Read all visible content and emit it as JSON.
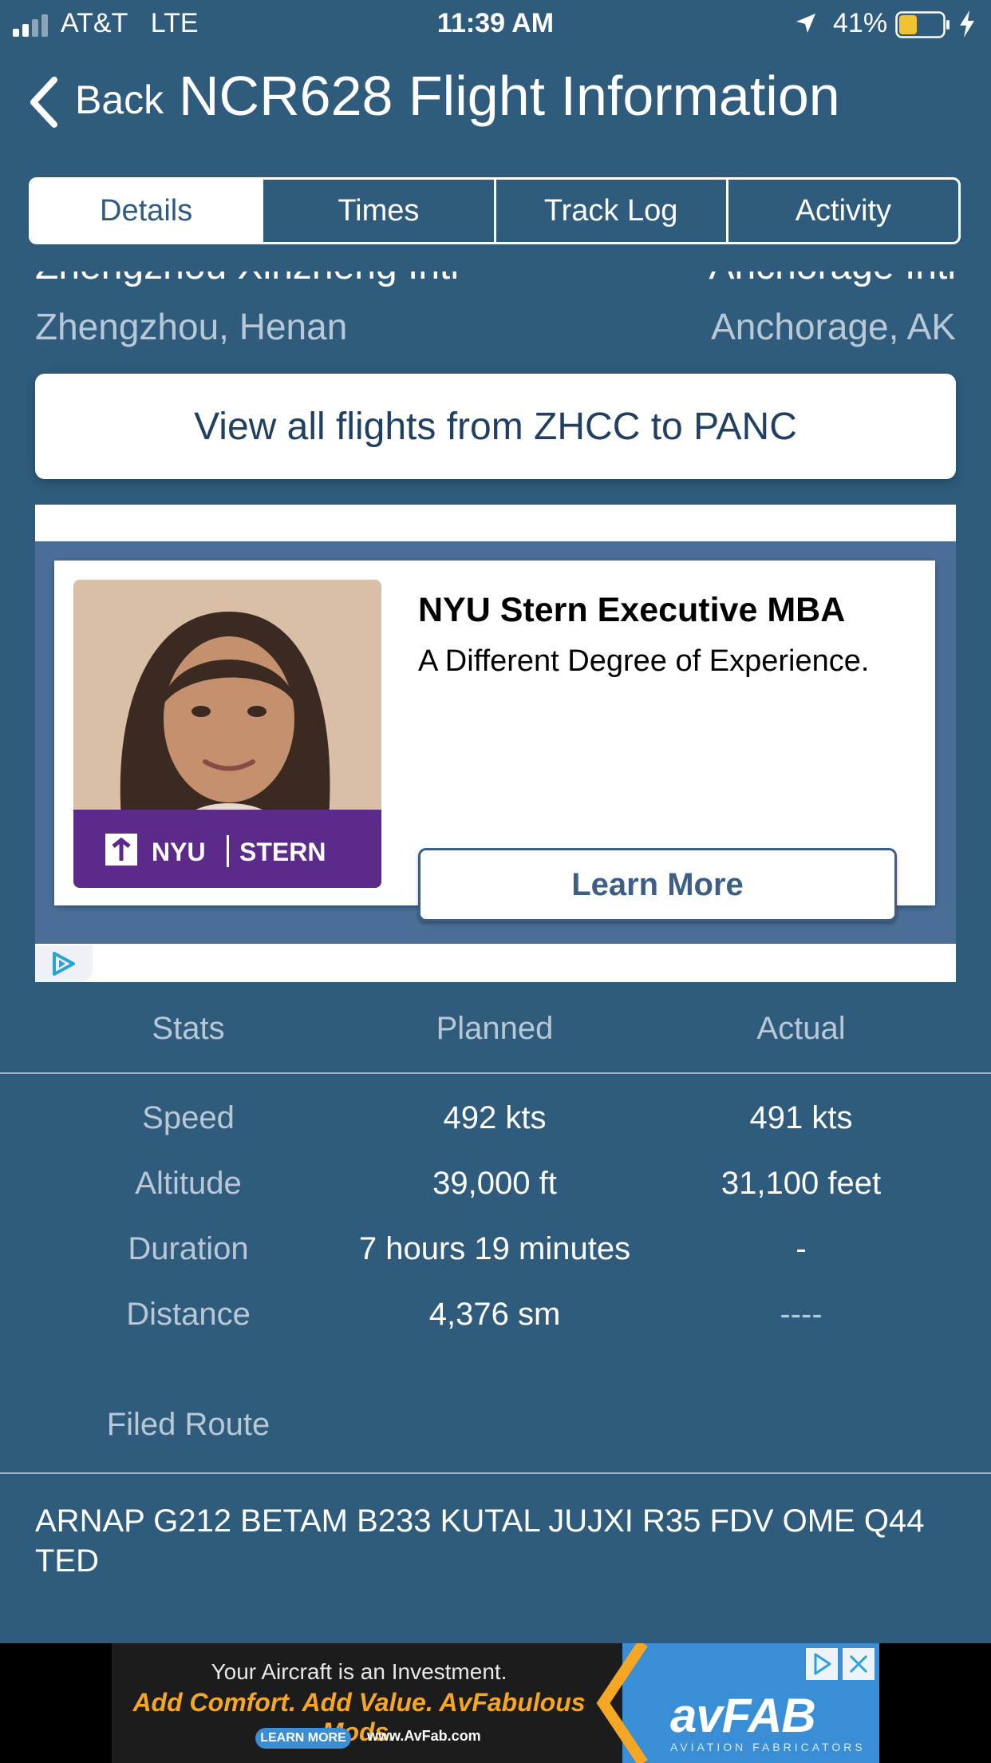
{
  "status_bar": {
    "carrier": "AT&T",
    "network": "LTE",
    "time": "11:39 AM",
    "battery_percent": "41%",
    "signal_bars_active": 2,
    "signal_bars_total": 4,
    "battery_level": 0.41,
    "battery_color": "#f2c230"
  },
  "nav": {
    "back_label": "Back",
    "title": "NCR628 Flight Information"
  },
  "tabs": [
    {
      "label": "Details",
      "active": true
    },
    {
      "label": "Times",
      "active": false
    },
    {
      "label": "Track Log",
      "active": false
    },
    {
      "label": "Activity",
      "active": false
    }
  ],
  "route": {
    "origin_name": "Zhengzhou Xinzheng Intl",
    "origin_city": "Zhengzhou, Henan",
    "destination_name": "Anchorage Intl",
    "destination_city": "Anchorage, AK"
  },
  "view_flights_button": "View all flights from ZHCC to PANC",
  "ad": {
    "headline": "NYU Stern Executive MBA",
    "body": "A Different Degree of Experience.",
    "cta": "Learn More",
    "logo_left": "NYU",
    "logo_right": "STERN",
    "background_color": "#4a6e98"
  },
  "stats": {
    "headers": [
      "Stats",
      "Planned",
      "Actual"
    ],
    "rows": [
      {
        "label": "Speed",
        "planned": "492 kts",
        "actual": "491 kts"
      },
      {
        "label": "Altitude",
        "planned": "39,000 ft",
        "actual": "31,100 feet"
      },
      {
        "label": "Duration",
        "planned": "7 hours 19 minutes",
        "actual": "-"
      },
      {
        "label": "Distance",
        "planned": "4,376 sm",
        "actual": "----"
      }
    ]
  },
  "filed_route": {
    "label": "Filed Route",
    "text": "ARNAP G212 BETAM B233 KUTAL JUJXI R35 FDV OME Q44 TED"
  },
  "banner_ad": {
    "line1": "Your Aircraft is an Investment.",
    "line2": "Add Comfort. Add Value. AvFabulous Mods.",
    "learn_more": "LEARN MORE",
    "url": "www.AvFab.com",
    "logo": "avFAB",
    "logo_sub": "AVIATION FABRICATORS"
  },
  "colors": {
    "background": "#2f5c7c",
    "secondary_text": "#b9c8d6",
    "button_text": "#1f3f63"
  }
}
